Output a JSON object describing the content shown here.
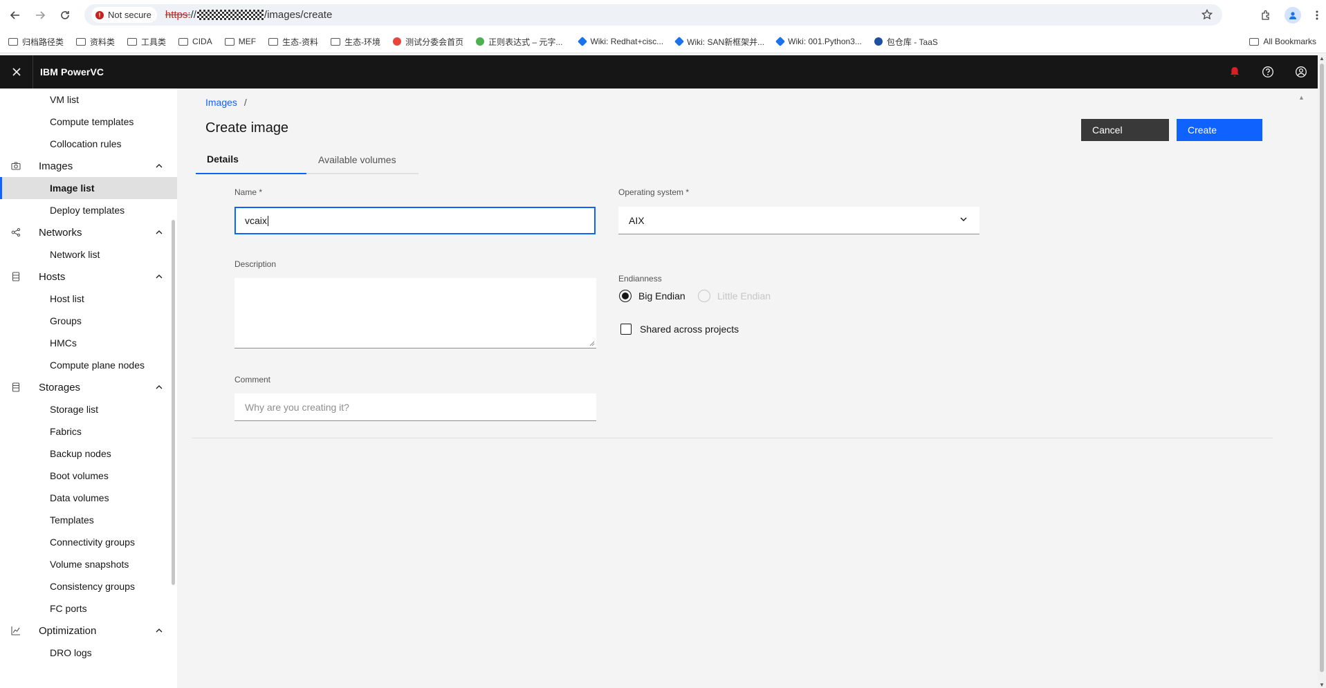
{
  "browser": {
    "security_label": "Not secure",
    "url_scheme": "https:",
    "url_slashes": "//",
    "url_path": "/images/create",
    "all_bookmarks": "All Bookmarks",
    "bookmarks": [
      {
        "label": "归档路径类",
        "icon": "folder-icon"
      },
      {
        "label": "资料类",
        "icon": "folder-icon"
      },
      {
        "label": "工具类",
        "icon": "folder-icon"
      },
      {
        "label": "CIDA",
        "icon": "folder-icon"
      },
      {
        "label": "MEF",
        "icon": "folder-icon"
      },
      {
        "label": "生态-资料",
        "icon": "folder-icon"
      },
      {
        "label": "生态-环境",
        "icon": "folder-icon"
      },
      {
        "label": "测试分委会首页",
        "icon": "site-icon",
        "color": "#e8453c"
      },
      {
        "label": "正则表达式 – 元字...",
        "icon": "site-icon",
        "color": "#4caf50"
      },
      {
        "label": "Wiki: Redhat+cisc...",
        "icon": "wiki-icon",
        "color": "#1a73e8"
      },
      {
        "label": "Wiki: SAN新框架并...",
        "icon": "wiki-icon",
        "color": "#1a73e8"
      },
      {
        "label": "Wiki: 001.Python3...",
        "icon": "wiki-icon",
        "color": "#1a73e8"
      },
      {
        "label": "包仓库 - TaaS",
        "icon": "site-icon",
        "color": "#1f4fa0"
      }
    ]
  },
  "app": {
    "product_name": "IBM PowerVC"
  },
  "sidebar": {
    "items": [
      {
        "label": "VM list",
        "type": "sub"
      },
      {
        "label": "Compute templates",
        "type": "sub"
      },
      {
        "label": "Collocation rules",
        "type": "sub"
      },
      {
        "label": "Images",
        "type": "group",
        "icon": "camera-icon"
      },
      {
        "label": "Image list",
        "type": "sub",
        "active": true
      },
      {
        "label": "Deploy templates",
        "type": "sub"
      },
      {
        "label": "Networks",
        "type": "group",
        "icon": "network-icon"
      },
      {
        "label": "Network list",
        "type": "sub"
      },
      {
        "label": "Hosts",
        "type": "group",
        "icon": "server-icon"
      },
      {
        "label": "Host list",
        "type": "sub"
      },
      {
        "label": "Groups",
        "type": "sub"
      },
      {
        "label": "HMCs",
        "type": "sub"
      },
      {
        "label": "Compute plane nodes",
        "type": "sub"
      },
      {
        "label": "Storages",
        "type": "group",
        "icon": "storage-icon"
      },
      {
        "label": "Storage list",
        "type": "sub"
      },
      {
        "label": "Fabrics",
        "type": "sub"
      },
      {
        "label": "Backup nodes",
        "type": "sub"
      },
      {
        "label": "Boot volumes",
        "type": "sub"
      },
      {
        "label": "Data volumes",
        "type": "sub"
      },
      {
        "label": "Templates",
        "type": "sub"
      },
      {
        "label": "Connectivity groups",
        "type": "sub"
      },
      {
        "label": "Volume snapshots",
        "type": "sub"
      },
      {
        "label": "Consistency groups",
        "type": "sub"
      },
      {
        "label": "FC ports",
        "type": "sub"
      },
      {
        "label": "Optimization",
        "type": "group",
        "icon": "chart-icon"
      },
      {
        "label": "DRO logs",
        "type": "sub"
      }
    ]
  },
  "main": {
    "breadcrumb": {
      "link": "Images",
      "sep": "/"
    },
    "title": "Create image",
    "cancel_label": "Cancel",
    "create_label": "Create",
    "tabs": [
      {
        "label": "Details",
        "active": true
      },
      {
        "label": "Available volumes",
        "active": false
      }
    ],
    "form": {
      "name_label": "Name *",
      "name_value": "vcaix",
      "os_label": "Operating system *",
      "os_value": "AIX",
      "description_label": "Description",
      "description_value": "",
      "endianness_label": "Endianness",
      "endian_big": "Big Endian",
      "endian_little": "Little Endian",
      "endian_selected": "Big Endian",
      "shared_label": "Shared across projects",
      "shared_checked": false,
      "comment_label": "Comment",
      "comment_placeholder": "Why are you creating it?"
    }
  },
  "colors": {
    "header_bg": "#161616",
    "primary": "#0f62fe",
    "secondary_btn": "#393939",
    "notification": "#da1e28"
  }
}
